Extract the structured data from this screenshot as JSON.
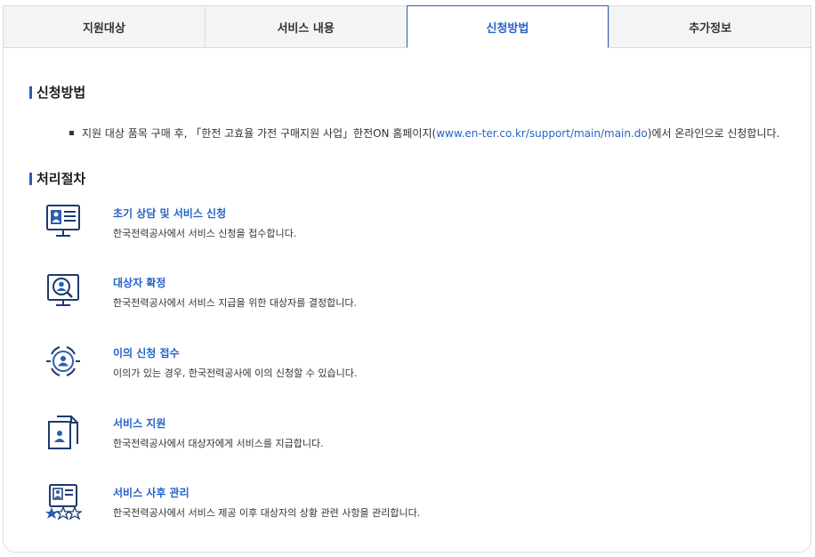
{
  "tabs": [
    {
      "label": "지원대상"
    },
    {
      "label": "서비스 내용"
    },
    {
      "label": "신청방법"
    },
    {
      "label": "추가정보"
    }
  ],
  "apply": {
    "title": "신청방법",
    "text_before": "지원 대상 품목 구매 후, 「한전 고효율 가전 구매지원 사업」한전ON 홈페이지(",
    "link": "www.en-ter.co.kr/support/main/main.do",
    "text_after": ")에서 온라인으로 신청합니다."
  },
  "process": {
    "title": "처리절차",
    "steps": [
      {
        "icon": "monitor-profile-icon",
        "title": "초기 상담 및 서비스 신청",
        "desc": "한국전력공사에서 서비스 신청을 접수합니다."
      },
      {
        "icon": "monitor-search-user-icon",
        "title": "대상자 확정",
        "desc": "한국전력공사에서 서비스 지급을 위한 대상자를 결정합니다."
      },
      {
        "icon": "target-user-icon",
        "title": "이의 신청 접수",
        "desc": "이의가 있는 경우, 한국전력공사에 이의 신청할 수 있습니다."
      },
      {
        "icon": "document-user-icon",
        "title": "서비스 지원",
        "desc": "한국전력공사에서 대상자에게 서비스를 지급합니다."
      },
      {
        "icon": "profile-rating-icon",
        "title": "서비스 사후 관리",
        "desc": "한국전력공사에서 서비스 제공 이후 대상자의 상황 관련 사항을 관리합니다."
      }
    ]
  },
  "colors": {
    "accent": "#2563c9",
    "icon_dark": "#1e3a6e",
    "icon_blue": "#2a5db0"
  }
}
